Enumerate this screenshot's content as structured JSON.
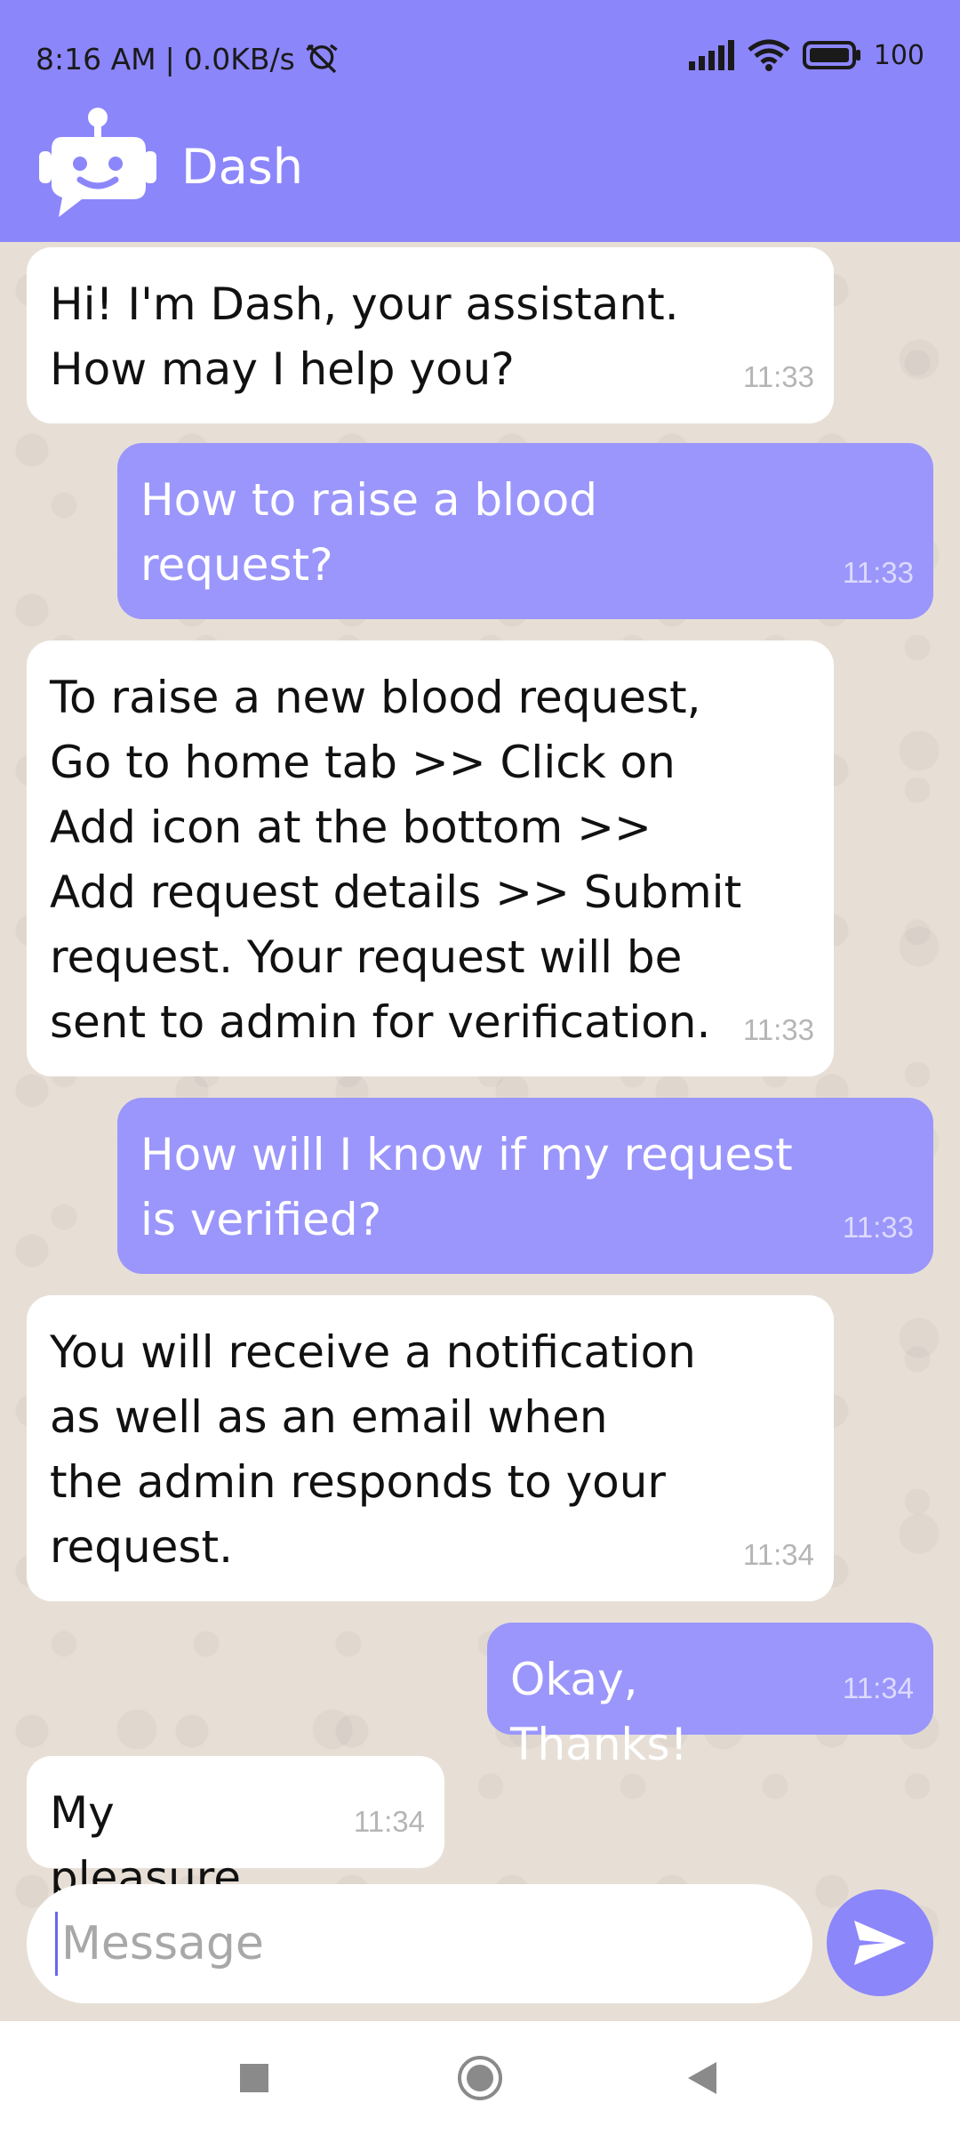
{
  "status_bar": {
    "time": "8:16 AM",
    "speed": "0.0KB/s",
    "battery": "100"
  },
  "app": {
    "title": "Dash",
    "accent_color": "#8c86fb"
  },
  "messages": [
    {
      "from": "bot",
      "text": "Hi! I'm Dash, your assistant.\nHow may I help you?",
      "time": "11:33"
    },
    {
      "from": "user",
      "text": "How to raise a blood\nrequest?",
      "time": "11:33"
    },
    {
      "from": "bot",
      "text": "To raise a new blood request,\nGo to home tab >> Click on\nAdd icon at the bottom >>\nAdd request details >> Submit\nrequest. Your request will be\nsent to admin for verification.",
      "time": "11:33"
    },
    {
      "from": "user",
      "text": "How will I know if my request\nis verified?",
      "time": "11:33"
    },
    {
      "from": "bot",
      "text": "You will receive a notification\nas well as an email when\nthe admin responds to your\nrequest.",
      "time": "11:34"
    },
    {
      "from": "user",
      "text": "Okay, Thanks!",
      "time": "11:34"
    },
    {
      "from": "bot",
      "text": "My pleasure.",
      "time": "11:34"
    }
  ],
  "composer": {
    "placeholder": "Message"
  }
}
